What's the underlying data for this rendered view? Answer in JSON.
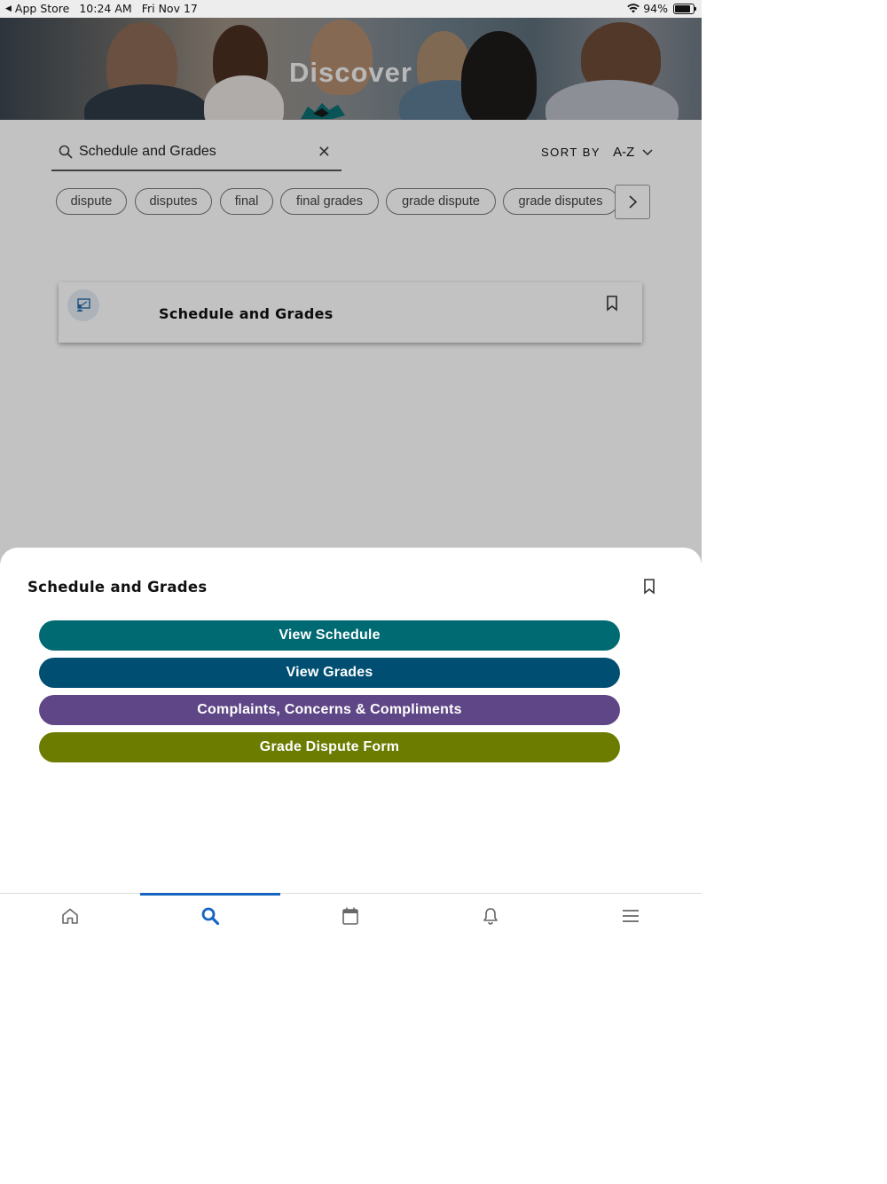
{
  "status_bar": {
    "back_app": "App Store",
    "time": "10:24 AM",
    "date": "Fri Nov 17",
    "battery": "94%",
    "battery_level": 0.94
  },
  "hero": {
    "title": "Discover"
  },
  "search": {
    "value": "Schedule and Grades"
  },
  "sort": {
    "label": "SORT BY",
    "value": "A-Z"
  },
  "chips": [
    "dispute",
    "disputes",
    "final",
    "final grades",
    "grade dispute",
    "grade disputes"
  ],
  "result_card": {
    "title": "Schedule  and  Grades"
  },
  "sheet": {
    "title": "Schedule  and  Grades",
    "actions": [
      {
        "label": "View Schedule",
        "color": "#006a72"
      },
      {
        "label": "View Grades",
        "color": "#004f72"
      },
      {
        "label": "Complaints, Concerns & Compliments",
        "color": "#5f4686"
      },
      {
        "label": "Grade Dispute Form",
        "color": "#6b7c00"
      }
    ]
  },
  "nav": {
    "items": [
      "home-icon",
      "search-icon",
      "calendar-icon",
      "bell-icon",
      "menu-icon"
    ],
    "active": "search-icon",
    "active_color": "#1565c0"
  }
}
